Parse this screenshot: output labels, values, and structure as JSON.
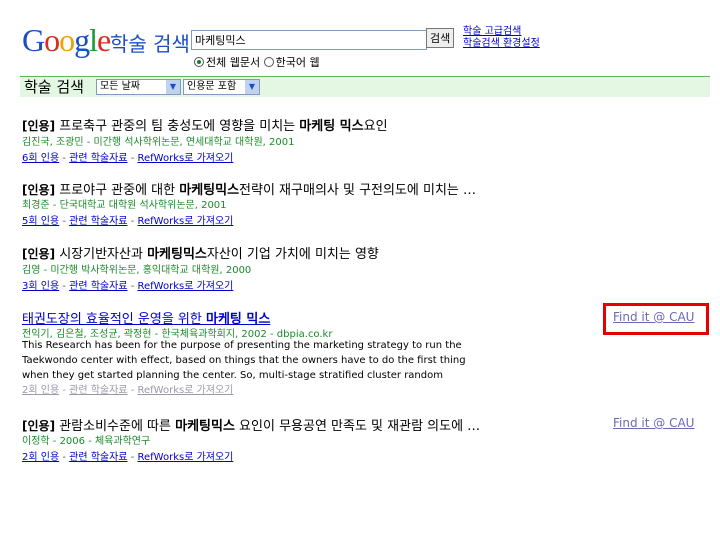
{
  "header": {
    "logo_letters": [
      "G",
      "o",
      "o",
      "g",
      "l",
      "e"
    ],
    "scholar_label": "학술 검색",
    "query": "마케팅믹스",
    "search_button": "검색",
    "advanced_link": "학술 고급검색",
    "prefs_link": "학술검색 환경설정",
    "radio_all": "전체 웹문서",
    "radio_korean": "한국어 웹"
  },
  "bar": {
    "title": "학술 검색",
    "date_select": "모든 날짜",
    "citation_select": "인용문 포함"
  },
  "results": [
    {
      "tag": "[인용]",
      "title_pre": " 프로축구 관중의 팀 충성도에 영향을 미치는 ",
      "title_bold": "마케팅 믹스",
      "title_post": "요인",
      "meta": "김진국,   조광민 - 미간행 석사학위논문, 연세대학교 대학원, 2001",
      "cited": "6회 인용",
      "related": "관련 학술자료",
      "refworks": "RefWorks로 가져오기"
    },
    {
      "tag": "[인용]",
      "title_pre": " 프로야구 관중에 대한 ",
      "title_bold": "마케팅믹스",
      "title_post": "전략이 재구매의사 및 구전의도에 미치는 …",
      "meta": "최경준 - 단국대학교 대학원 석사학위논문, 2001",
      "cited": "5회 인용",
      "related": "관련 학술자료",
      "refworks": "RefWorks로 가져오기"
    },
    {
      "tag": "[인용]",
      "title_pre": " 시장기반자산과 ",
      "title_bold": "마케팅믹스",
      "title_post": "자산이 기업 가치에 미치는 영향",
      "meta": "김영 - 미간행 박사학위논문, 홍익대학교 대학원, 2000",
      "cited": "3회 인용",
      "related": "관련 학술자료",
      "refworks": "RefWorks로 가져오기"
    },
    {
      "title_pre": "태권도장의 효율적인 운영을 위한 ",
      "title_bold": "마케팅 믹스",
      "meta": "전익기,   김은철,   조성균,   곽정현 - 한국체육과학회지, 2002 - dbpia.co.kr",
      "snippet": "This Research has been for the purpose of presenting the marketing strategy to run the Taekwondo center with effect, based on things that the owners have to do the first thing when they get started planning the center. So, multi-stage stratified cluster random sampling(MSCRS) has been ...",
      "cited": "2회 인용",
      "related": "관련 학술자료",
      "refworks": "RefWorks로 가져오기",
      "findit": "Find it @ CAU"
    },
    {
      "tag": "[인용]",
      "title_pre": " 관람소비수준에 따른 ",
      "title_bold": "마케팅믹스",
      "title_post": " 요인이 무용공연 만족도 및 재관람 의도에 …",
      "meta": "이정학 - 2006 - 체육과학연구",
      "cited": "2회 인용",
      "related": "관련 학술자료",
      "refworks": "RefWorks로 가져오기",
      "findit": "Find it @ CAU"
    }
  ],
  "colors": {
    "link": "#0000cc",
    "meta": "#1a8a2a",
    "highlight_box": "#e60000",
    "bar": "#e3f7e3"
  }
}
